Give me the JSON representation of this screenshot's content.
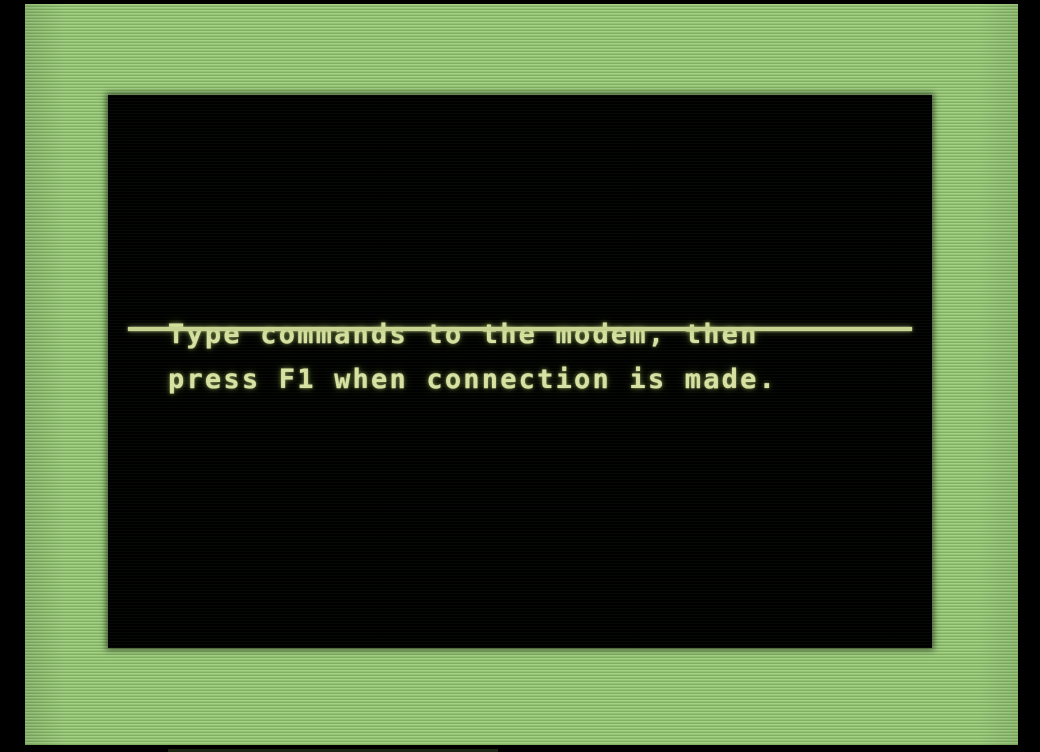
{
  "display": {
    "device": "CRT green-phosphor monitor",
    "bezel_color": "#000000",
    "phosphor_color": "#9ac97e",
    "phosphor_scanline_color": "#7fb05f",
    "screen_background": "#000000",
    "text_color": "#d9e2a4",
    "divider_color": "#c9d492"
  },
  "terminal": {
    "lines": [
      "Type commands to the modem, then",
      "press F1 when connection is made."
    ],
    "line1": "Type commands to the modem, then",
    "line2": "press F1 when connection is made.",
    "divider_present": true,
    "function_key": "F1",
    "subject": "modem"
  }
}
